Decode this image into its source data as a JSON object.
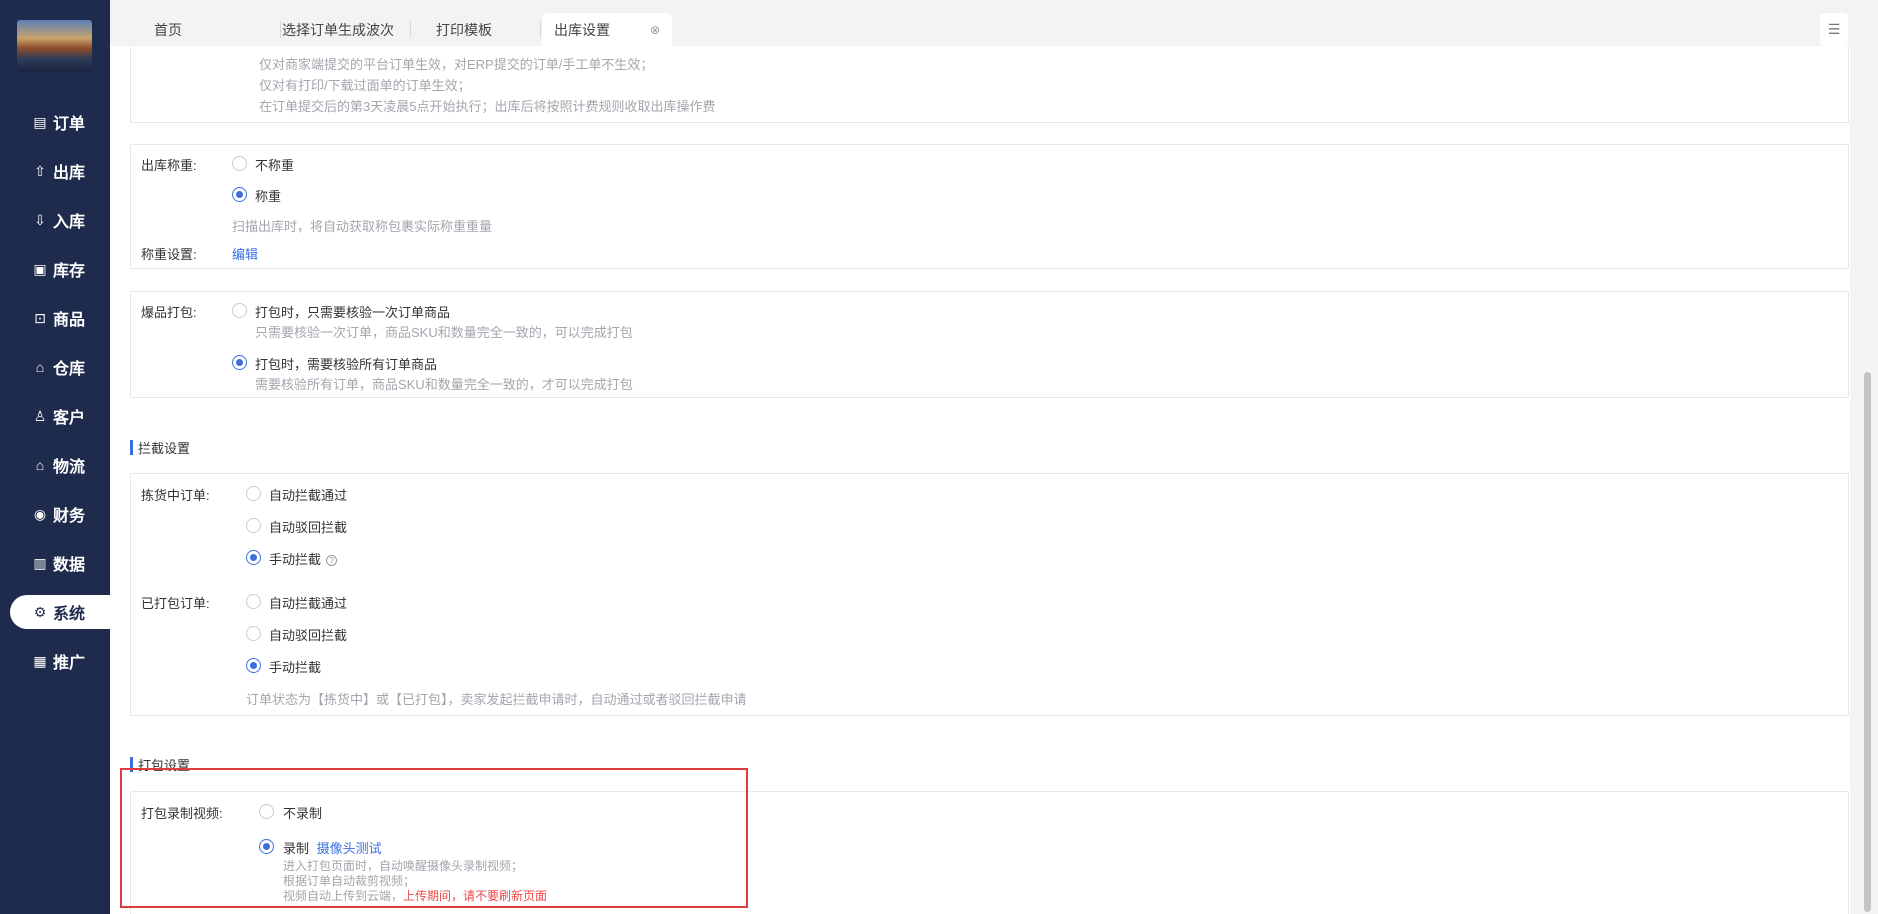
{
  "sidebar": {
    "items": [
      {
        "label": "订单",
        "icon": "order-icon",
        "glyph": "▤"
      },
      {
        "label": "出库",
        "icon": "outbound-icon",
        "glyph": "⇧"
      },
      {
        "label": "入库",
        "icon": "inbound-icon",
        "glyph": "⇩"
      },
      {
        "label": "库存",
        "icon": "inventory-icon",
        "glyph": "▣"
      },
      {
        "label": "商品",
        "icon": "goods-icon",
        "glyph": "⊡"
      },
      {
        "label": "仓库",
        "icon": "warehouse-icon",
        "glyph": "⌂"
      },
      {
        "label": "客户",
        "icon": "customer-icon",
        "glyph": "♙"
      },
      {
        "label": "物流",
        "icon": "logistics-icon",
        "glyph": "⌂"
      },
      {
        "label": "财务",
        "icon": "finance-icon",
        "glyph": "◉"
      },
      {
        "label": "数据",
        "icon": "data-icon",
        "glyph": "▥"
      },
      {
        "label": "系统",
        "icon": "settings-icon",
        "glyph": "⚙"
      },
      {
        "label": "推广",
        "icon": "promotion-icon",
        "glyph": "▦"
      }
    ],
    "active_index": 10
  },
  "tabs": [
    {
      "label": "首页"
    },
    {
      "label": "选择订单生成波次"
    },
    {
      "label": "打印模板"
    },
    {
      "label": "出库设置",
      "active": true
    }
  ],
  "top_notes": [
    "仅对商家端提交的平台订单生效，对ERP提交的订单/手工单不生效；",
    "仅对有打印/下载过面单的订单生效；",
    "在订单提交后的第3天凌晨5点开始执行；出库后将按照计费规则收取出库操作费"
  ],
  "weighing": {
    "label": "出库称重:",
    "options": [
      "不称重",
      "称重"
    ],
    "selected": 1,
    "hint": "扫描出库时，将自动获取称包裹实际称重重量",
    "setting_label": "称重设置:",
    "edit_link": "编辑"
  },
  "bulk_pack": {
    "label": "爆品打包:",
    "options": [
      {
        "title": "打包时，只需要核验一次订单商品",
        "desc": "只需要核验一次订单，商品SKU和数量完全一致的，可以完成打包"
      },
      {
        "title": "打包时，需要核验所有订单商品",
        "desc": "需要核验所有订单，商品SKU和数量完全一致的，才可以完成打包"
      }
    ],
    "selected": 1
  },
  "intercept": {
    "section_title": "拦截设置",
    "picking_label": "拣货中订单:",
    "picking_options": [
      "自动拦截通过",
      "自动驳回拦截",
      "手动拦截"
    ],
    "picking_selected": 2,
    "packed_label": "已打包订单:",
    "packed_options": [
      "自动拦截通过",
      "自动驳回拦截",
      "手动拦截"
    ],
    "packed_selected": 2,
    "hint": "订单状态为【拣货中】或【已打包】，卖家发起拦截申请时，自动通过或者驳回拦截申请"
  },
  "packing": {
    "section_title": "打包设置",
    "video_label": "打包录制视频:",
    "options": [
      "不录制",
      "录制"
    ],
    "selected": 1,
    "camera_test_link": "摄像头测试",
    "notes": [
      "进入打包页面时，自动唤醒摄像头录制视频；",
      "根据订单自动裁剪视频；"
    ],
    "upload_note": "视频自动上传到云端，",
    "upload_warning": "上传期间，请不要刷新页面"
  }
}
